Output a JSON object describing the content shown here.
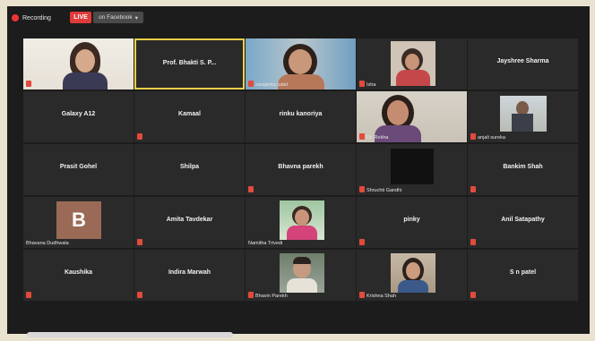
{
  "topbar": {
    "recording_label": "Recording",
    "live_label": "LIVE",
    "live_destination": "on Facebook"
  },
  "participants": [
    {
      "name": "Krutu Shah",
      "display": "label"
    },
    {
      "name": "Prof. Bhakti S. P...",
      "display": "center",
      "active": true
    },
    {
      "name": "sangeeta patel",
      "display": "label"
    },
    {
      "name": "Isha",
      "display": "label"
    },
    {
      "name": "Jayshree Sharma",
      "display": "center"
    },
    {
      "name": "Galaxy A12",
      "display": "center"
    },
    {
      "name": "Kamaal",
      "display": "center"
    },
    {
      "name": "rinku kanoriya",
      "display": "center"
    },
    {
      "name": "Dr. Rekha",
      "display": "label"
    },
    {
      "name": "anjali sureka",
      "display": "label"
    },
    {
      "name": "Prasit Gohel",
      "display": "center"
    },
    {
      "name": "Shilpa",
      "display": "center"
    },
    {
      "name": "Bhavna parekh",
      "display": "center"
    },
    {
      "name": "Shruchti Gandhi",
      "display": "label"
    },
    {
      "name": "Bankim Shah",
      "display": "center"
    },
    {
      "name": "Bhavana Dudhwala",
      "display": "label",
      "avatar_letter": "B"
    },
    {
      "name": "Amita Tavdekar",
      "display": "center"
    },
    {
      "name": "Namitha Trivedi",
      "display": "label"
    },
    {
      "name": "pinky",
      "display": "center"
    },
    {
      "name": "Anil Satapathy",
      "display": "center"
    },
    {
      "name": "Kaushika",
      "display": "center"
    },
    {
      "name": "Indira Marwah",
      "display": "center"
    },
    {
      "name": "Bhavin Parekh",
      "display": "label"
    },
    {
      "name": "Krishna Shah",
      "display": "label"
    },
    {
      "name": "S n patel",
      "display": "center"
    }
  ],
  "colors": {
    "tile_bg": "#2a2a2a",
    "active_border": "#f0d048",
    "mute_red": "#e24a3c",
    "live_red": "#e03a3a"
  }
}
